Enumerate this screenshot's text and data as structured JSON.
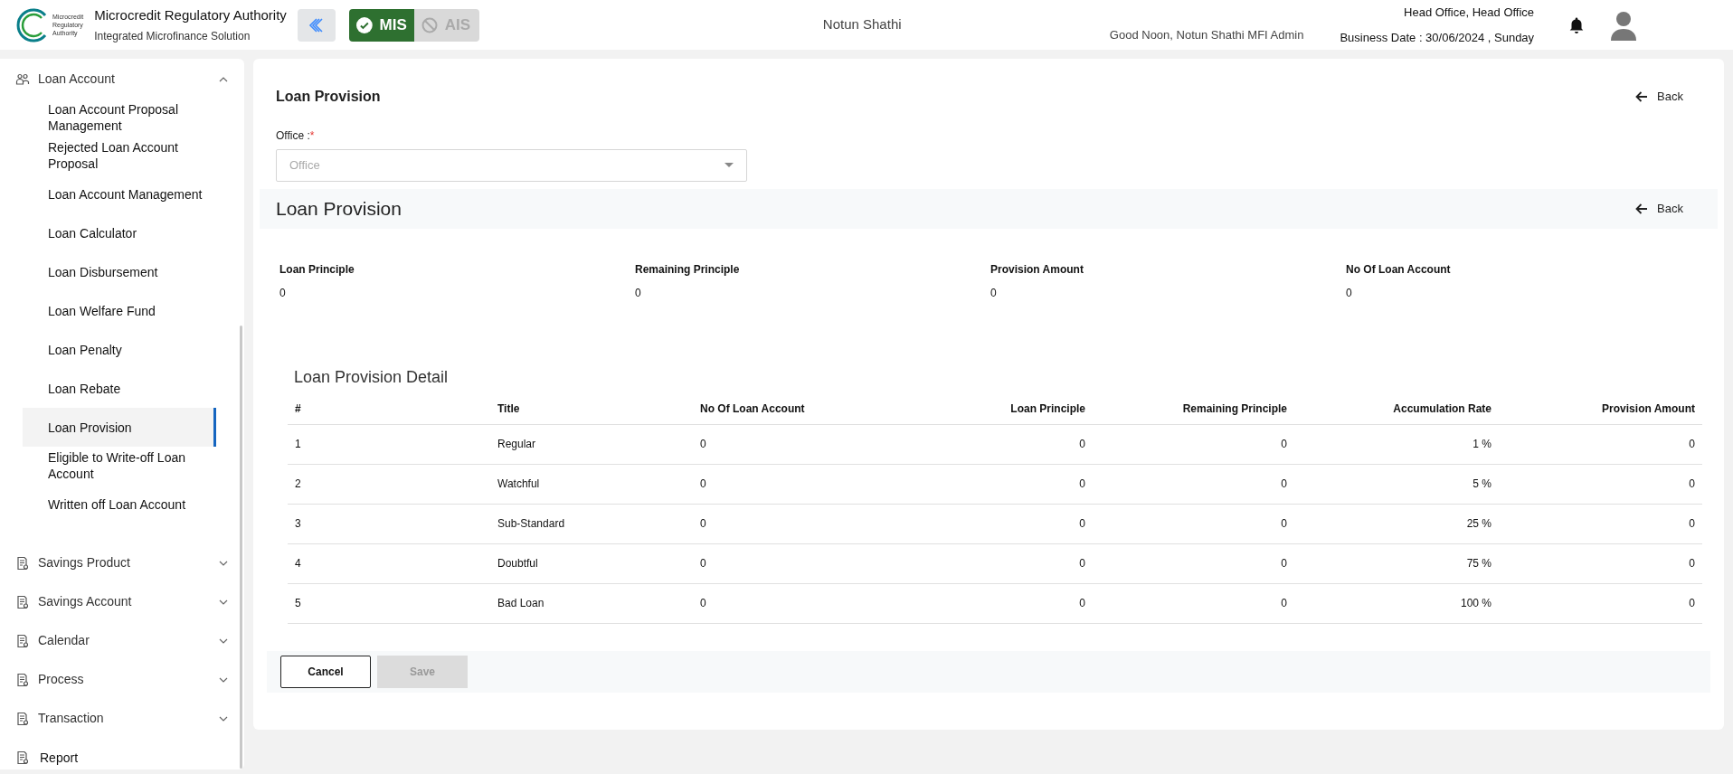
{
  "header": {
    "logo_text": [
      "Microcredit",
      "Regulatory",
      "Authority"
    ],
    "org_name": "Microcredit Regulatory Authority",
    "org_subtitle": "Integrated Microfinance Solution",
    "modules": [
      {
        "label": "MIS",
        "selected": true
      },
      {
        "label": "AIS",
        "selected": false
      }
    ],
    "company": "Notun Shathi",
    "greeting": "Good Noon, Notun Shathi MFI Admin",
    "office": "Head Office, Head Office",
    "business_date": "Business Date : 30/06/2024 , Sunday"
  },
  "sidebar": {
    "items": [
      {
        "kind": "group",
        "label": "Loan Account",
        "expanded": true,
        "children": [
          {
            "label": "Loan Account Proposal Management",
            "selected": false
          },
          {
            "label": "Rejected Loan Account Proposal",
            "selected": false
          },
          {
            "label": "Loan Account Management",
            "selected": false
          },
          {
            "label": "Loan Calculator",
            "selected": false
          },
          {
            "label": "Loan Disbursement",
            "selected": false
          },
          {
            "label": "Loan Welfare Fund",
            "selected": false
          },
          {
            "label": "Loan Penalty",
            "selected": false
          },
          {
            "label": "Loan Rebate",
            "selected": false
          },
          {
            "label": "Loan Provision",
            "selected": true
          },
          {
            "label": "Eligible to Write-off Loan Account",
            "selected": false
          },
          {
            "label": "Written off Loan Account",
            "selected": false
          }
        ]
      },
      {
        "kind": "group",
        "label": "Savings Product",
        "expanded": false
      },
      {
        "kind": "group",
        "label": "Savings Account",
        "expanded": false
      },
      {
        "kind": "group",
        "label": "Calendar",
        "expanded": false
      },
      {
        "kind": "group",
        "label": "Process",
        "expanded": false
      },
      {
        "kind": "group",
        "label": "Transaction",
        "expanded": false
      },
      {
        "kind": "link",
        "label": "Report"
      }
    ]
  },
  "page": {
    "title": "Loan Provision",
    "back": "Back",
    "office_field": {
      "label": "Office :",
      "required_mark": "*",
      "placeholder": "Office"
    },
    "section": {
      "title": "Loan Provision",
      "back": "Back"
    },
    "summary": [
      {
        "label": "Loan Principle",
        "value": "0"
      },
      {
        "label": "Remaining Principle",
        "value": "0"
      },
      {
        "label": "Provision Amount",
        "value": "0"
      },
      {
        "label": "No Of Loan Account",
        "value": "0"
      }
    ],
    "detail": {
      "title": "Loan Provision Detail",
      "columns": [
        "#",
        "Title",
        "No Of Loan Account",
        "Loan Principle",
        "Remaining Principle",
        "Accumulation Rate",
        "Provision Amount"
      ],
      "rows": [
        [
          "1",
          "Regular",
          "0",
          "0",
          "0",
          "1 %",
          "0"
        ],
        [
          "2",
          "Watchful",
          "0",
          "0",
          "0",
          "5 %",
          "0"
        ],
        [
          "3",
          "Sub-Standard",
          "0",
          "0",
          "0",
          "25 %",
          "0"
        ],
        [
          "4",
          "Doubtful",
          "0",
          "0",
          "0",
          "75 %",
          "0"
        ],
        [
          "5",
          "Bad Loan",
          "0",
          "0",
          "0",
          "100 %",
          "0"
        ]
      ]
    },
    "buttons": [
      {
        "label": "Cancel",
        "disabled": false
      },
      {
        "label": "Save",
        "disabled": true
      }
    ]
  }
}
